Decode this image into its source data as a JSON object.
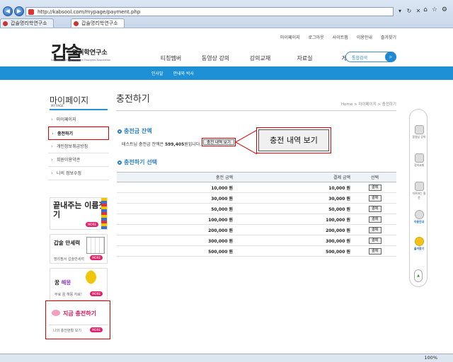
{
  "browser": {
    "url": "http://kabsool.com/mypage/payment.php",
    "tabs": [
      "갑술명리학연구소",
      "갑술명리학연구소"
    ],
    "zoom": "100%"
  },
  "header": {
    "util_links": [
      "마이페이지",
      "로그아웃",
      "사이트맵",
      "이용안내",
      "즐겨찾기"
    ],
    "logo_mark": "갑술",
    "logo_name": "명리학연구소",
    "logo_sub": "Kab-Sool Naming Institute Thoughts Association",
    "gnb": [
      "티칭멤버",
      "동영상 강의",
      "강의교재",
      "자료실",
      "게시판"
    ],
    "search_placeholder": "통합검색",
    "sub_nav": [
      "인사말",
      "안내와 박사"
    ]
  },
  "sidebar": {
    "title": "마이페이지",
    "subtitle": "MY PAGE",
    "items": [
      "마이페이지",
      "충전하기",
      "개인정보취급방침",
      "회원이용약관",
      "나의 정보수정"
    ],
    "banners": {
      "b1_title": "끝내주는 이름짓기",
      "b2_title": "갑술 만세력",
      "b2_sub": "명리필서 갑술만세력",
      "b3_title_a": "꿈",
      "b3_title_b": "해몽",
      "b3_sub": "무료 꿈 해몽 자료!",
      "b4_title": "지금 충전하기",
      "b4_sub": "나의 충전현황 보기",
      "more": "MORE"
    }
  },
  "main": {
    "title": "충전하기",
    "breadcrumb": "Home > 마이페이지 > 충전하기",
    "balance_heading": "충전금 잔액",
    "balance_prefix": "테스트님 충전금 잔액은",
    "balance_amount": "599,405",
    "balance_suffix": "원입니다.",
    "history_button": "충전 내역 보기",
    "callout_button": "충전 내역 보기",
    "select_heading": "충전하기 선택",
    "table_headers": [
      "충전 금액",
      "결제 금액",
      "선택"
    ],
    "rows": [
      {
        "charge": "10,000 원",
        "pay": "10,000 원",
        "select": "결제"
      },
      {
        "charge": "30,000 원",
        "pay": "30,000 원",
        "select": "결제"
      },
      {
        "charge": "50,000 원",
        "pay": "50,000 원",
        "select": "결제"
      },
      {
        "charge": "100,000 원",
        "pay": "100,000 원",
        "select": "결제"
      },
      {
        "charge": "200,000 원",
        "pay": "200,000 원",
        "select": "결제"
      },
      {
        "charge": "300,000 원",
        "pay": "300,000 원",
        "select": "결제"
      },
      {
        "charge": "500,000 원",
        "pay": "500,000 원",
        "select": "결제"
      }
    ]
  },
  "quickbar": {
    "items": [
      "동영상 강의",
      "강의교재",
      "자주하는 질문",
      "이용안내",
      "즐겨찾기"
    ]
  },
  "colors": {
    "accent": "#1e90d6",
    "highlight": "#dd0000",
    "pink": "#e0226b"
  }
}
